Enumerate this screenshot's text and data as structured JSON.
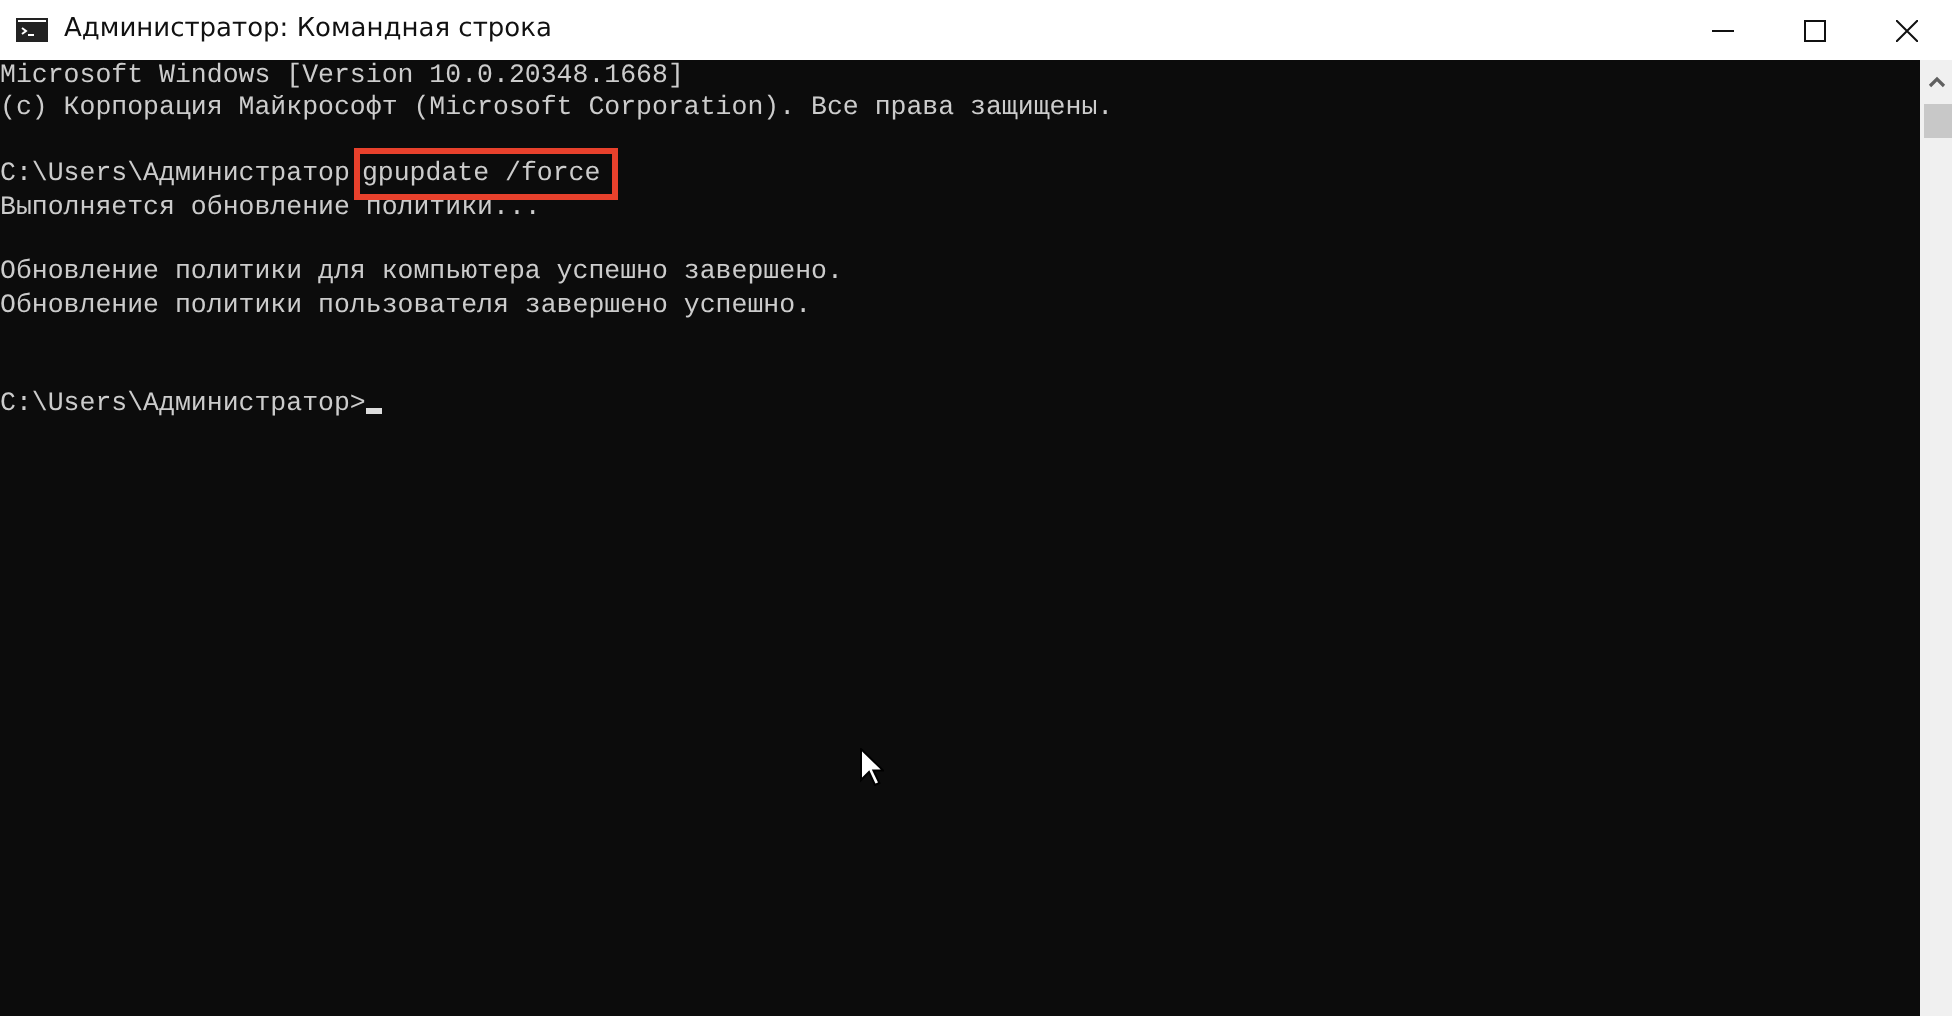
{
  "window": {
    "title": "Администратор: Командная строка"
  },
  "console": {
    "lines": [
      {
        "kind": "output",
        "text": "Microsoft Windows [Version 10.0.20348.1668]"
      },
      {
        "kind": "output",
        "text": "(c) Корпорация Майкрософт (Microsoft Corporation). Все права защищены."
      },
      {
        "kind": "blank"
      },
      {
        "kind": "command",
        "prompt": "C:\\Users\\Администратор",
        "command": "gpupdate /force",
        "highlighted": true
      },
      {
        "kind": "output",
        "text": "Выполняется обновление политики..."
      },
      {
        "kind": "blank"
      },
      {
        "kind": "output",
        "text": "Обновление политики для компьютера успешно завершено."
      },
      {
        "kind": "output",
        "text": "Обновление политики пользователя завершено успешно."
      },
      {
        "kind": "blank"
      },
      {
        "kind": "blank"
      },
      {
        "kind": "input",
        "prompt": "C:\\Users\\Администратор>",
        "cursor": true
      }
    ]
  }
}
